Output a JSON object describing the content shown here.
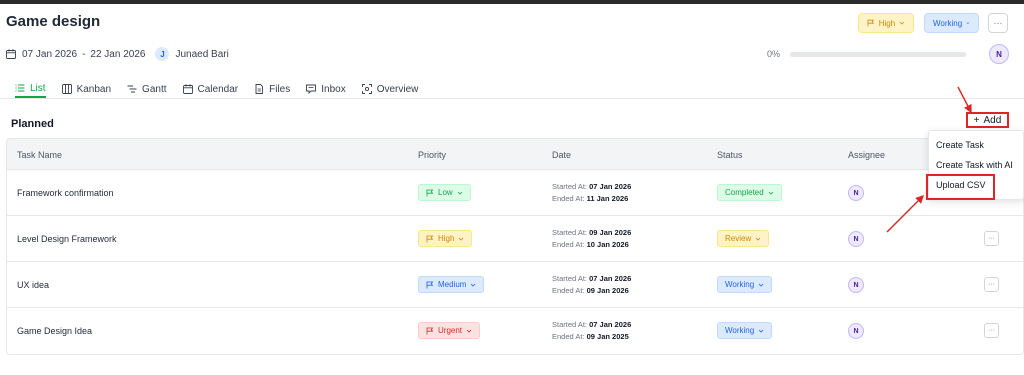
{
  "project": {
    "title": "Game design",
    "start_date": "07 Jan 2026",
    "date_separator": "-",
    "end_date": "22 Jan 2026",
    "owner_initial": "J",
    "owner_name": "Junaed Bari",
    "priority_label": "High",
    "status_label": "Working",
    "more_label": "···",
    "progress_text": "0%",
    "progress_value": 0,
    "current_user_initial": "N"
  },
  "tabs": [
    {
      "label": "List",
      "icon": "list-icon",
      "active": true
    },
    {
      "label": "Kanban",
      "icon": "kanban-icon",
      "active": false
    },
    {
      "label": "Gantt",
      "icon": "gantt-icon",
      "active": false
    },
    {
      "label": "Calendar",
      "icon": "calendar-icon",
      "active": false
    },
    {
      "label": "Files",
      "icon": "file-icon",
      "active": false
    },
    {
      "label": "Inbox",
      "icon": "inbox-icon",
      "active": false
    },
    {
      "label": "Overview",
      "icon": "overview-icon",
      "active": false
    }
  ],
  "section": {
    "title": "Planned",
    "add_plus": "+",
    "add_label": "Add"
  },
  "table": {
    "columns": [
      "Task Name",
      "Priority",
      "Date",
      "Status",
      "Assignee"
    ],
    "started_label": "Started At:",
    "ended_label": "Ended At:",
    "rows": [
      {
        "name": "Framework confirmation",
        "priority": "Low",
        "started": "07 Jan 2026",
        "ended": "11 Jan 2026",
        "status": "Completed",
        "assignee": "N",
        "more": "···"
      },
      {
        "name": "Level Design Framework",
        "priority": "High",
        "started": "09 Jan 2026",
        "ended": "10 Jan 2026",
        "status": "Review",
        "assignee": "N",
        "more": "···"
      },
      {
        "name": "UX idea",
        "priority": "Medium",
        "started": "07 Jan 2026",
        "ended": "09 Jan 2026",
        "status": "Working",
        "assignee": "N",
        "more": "···"
      },
      {
        "name": "Game Design Idea",
        "priority": "Urgent",
        "started": "07 Jan 2026",
        "ended": "09 Jan 2025",
        "status": "Working",
        "assignee": "N",
        "more": "···"
      }
    ]
  },
  "add_menu": {
    "items": [
      "Create Task",
      "Create Task with AI",
      "Upload CSV"
    ]
  },
  "colors": {
    "accent_green": "#16a34a",
    "annotation_red": "#dc2626",
    "low": "#16a34a",
    "high": "#ca8a04",
    "medium": "#2563eb",
    "urgent": "#dc2626"
  }
}
